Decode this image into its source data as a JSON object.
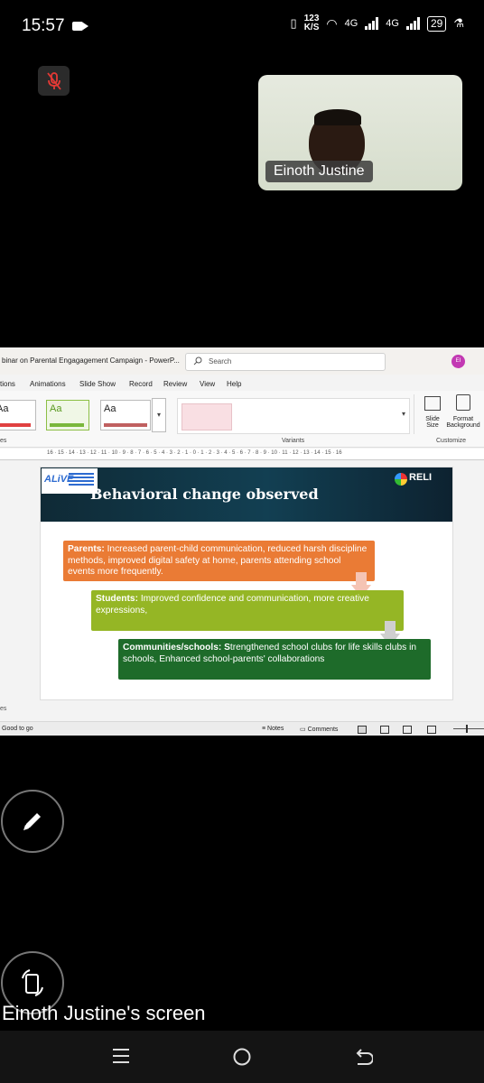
{
  "status_bar": {
    "time": "15:57",
    "net_speed_top": "123",
    "net_speed_bottom": "K/S",
    "signal1_label": "4G",
    "signal2_label": "4G",
    "battery": "29"
  },
  "participant": {
    "name": "Einoth Justine"
  },
  "powerpoint": {
    "doc_title": "binar on Parental Engagagement Campaign  -  PowerP...",
    "search_placeholder": "Search",
    "avatar_initials": "EI",
    "tabs": [
      "tions",
      "Animations",
      "Slide Show",
      "Record",
      "Review",
      "View",
      "Help"
    ],
    "themes": [
      {
        "label": "Aa",
        "bar_color": "#e04040"
      },
      {
        "label": "Aa",
        "bar_color": "#7ab83c"
      },
      {
        "label": "Aa",
        "bar_color": "#c06060"
      }
    ],
    "group_left_label": "es",
    "variants_label": "Variants",
    "customize_label": "Customize",
    "slide_size_label": "Slide Size",
    "format_background_label": "Format Background",
    "ruler_text": "16 · 15 · 14 · 13 · 12 · 11 · 10 · 9 · 8 · 7 · 6 · 5 · 4 · 3 · 2 · 1 · 0 · 1 · 2 · 3 · 4 · 5 · 6 · 7 · 8 · 9 · 10 · 11 · 12 · 13 · 14 · 15 · 16",
    "notes_left": "es",
    "status_left": "Good to go",
    "notes_btn": "Notes",
    "comments_btn": "Comments"
  },
  "slide": {
    "title": "Behavioral change observed",
    "alive_logo": "ALiVE",
    "reli_logo": "RELI",
    "items": [
      {
        "label": "Parents:",
        "text": " Increased parent-child communication, reduced harsh discipline methods, improved digital safety at home, parents attending school events more frequently."
      },
      {
        "label": "Students:",
        "text": " Improved confidence and communication, more creative expressions,"
      },
      {
        "label": "Communities/schools: S",
        "text": "trengthened school clubs for life skills clubs in schools, Enhanced school-parents' collaborations"
      }
    ]
  },
  "screen_share": {
    "caption": "Einoth Justine's screen"
  }
}
